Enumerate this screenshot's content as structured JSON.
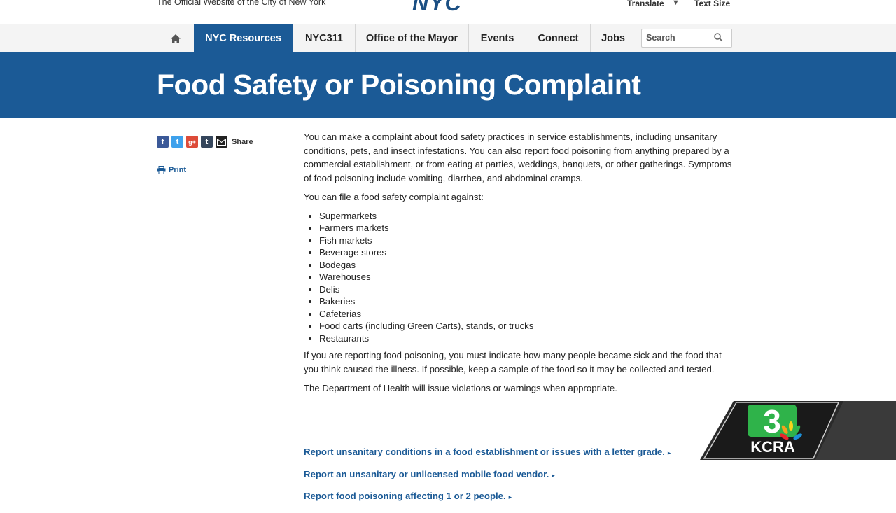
{
  "header": {
    "tagline": "The Official Website of the City of New York",
    "logo": "NYC",
    "translate": "Translate",
    "translate_caret": "▼",
    "text_size": "Text Size"
  },
  "nav": {
    "items": [
      "NYC Resources",
      "NYC311",
      "Office of the Mayor",
      "Events",
      "Connect",
      "Jobs"
    ],
    "active": "NYC Resources",
    "search_placeholder": "Search"
  },
  "page": {
    "title": "Food Safety or Poisoning Complaint"
  },
  "sidebar": {
    "share_label": "Share",
    "print_label": "Print",
    "share_icons": [
      "facebook-icon",
      "twitter-icon",
      "google-plus-icon",
      "tumblr-icon",
      "email-icon"
    ]
  },
  "content": {
    "intro": "You can make a complaint about food safety practices in service establishments, including unsanitary conditions, pets, and insect infestations. You can also report food poisoning from anything prepared by a commercial establishment, or from eating at parties, weddings, banquets, or other gatherings. Symptoms of food poisoning include vomiting, diarrhea, and abdominal cramps.",
    "list_intro": "You can file a food safety complaint against:",
    "list": [
      "Supermarkets",
      "Farmers markets",
      "Fish markets",
      "Beverage stores",
      "Bodegas",
      "Warehouses",
      "Delis",
      "Bakeries",
      "Cafeterias",
      "Food carts (including Green Carts), stands, or trucks",
      "Restaurants"
    ],
    "poisoning_note": "If you are reporting food poisoning, you must indicate how many people became sick and the food that you think caused the illness. If possible, keep a sample of the food so it may be collected and tested.",
    "doh_note": "The Department of Health will issue violations or warnings when appropriate."
  },
  "links": [
    "Report unsanitary conditions in a food establishment or issues with a letter grade.",
    "Report an unsanitary or unlicensed mobile food vendor.",
    "Report food poisoning affecting 1 or 2 people."
  ],
  "overlay": {
    "channel_number": "3",
    "station": "KCRA"
  },
  "colors": {
    "nyc_blue": "#1b5a96",
    "kcra_green": "#2fb34a",
    "kcra_dark": "#222222"
  }
}
